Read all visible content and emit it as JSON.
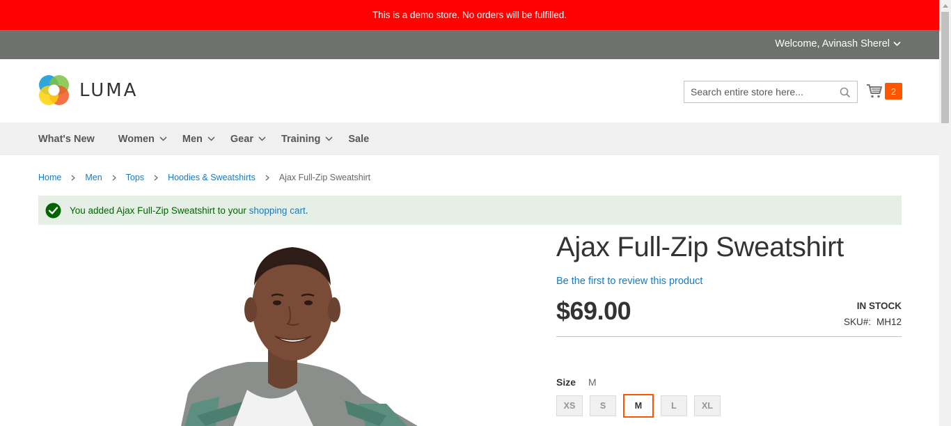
{
  "demo_notice": "This is a demo store. No orders will be fulfilled.",
  "header": {
    "welcome": "Welcome, Avinash Sherel",
    "logo_text": "LUMA",
    "search_placeholder": "Search entire store here...",
    "cart_count": "2"
  },
  "nav": {
    "items": [
      {
        "label": "What's New",
        "has_dropdown": false
      },
      {
        "label": "Women",
        "has_dropdown": true
      },
      {
        "label": "Men",
        "has_dropdown": true
      },
      {
        "label": "Gear",
        "has_dropdown": true
      },
      {
        "label": "Training",
        "has_dropdown": true
      },
      {
        "label": "Sale",
        "has_dropdown": false
      }
    ]
  },
  "breadcrumb": {
    "items": [
      "Home",
      "Men",
      "Tops",
      "Hoodies & Sweatshirts"
    ],
    "current": "Ajax Full-Zip Sweatshirt"
  },
  "message": {
    "prefix": "You added Ajax Full-Zip Sweatshirt to your ",
    "link": "shopping cart",
    "suffix": "."
  },
  "product": {
    "title": "Ajax Full-Zip Sweatshirt",
    "review_link": "Be the first to review this product",
    "price": "$69.00",
    "stock": "IN STOCK",
    "sku_label": "SKU#:",
    "sku_value": "MH12",
    "size_label": "Size",
    "size_selected": "M",
    "sizes": [
      "XS",
      "S",
      "M",
      "L",
      "XL"
    ]
  },
  "colors": {
    "demo_bar": "#ff0101",
    "panel_bar": "#6e716e",
    "link": "#1979c3",
    "accent": "#ff5501",
    "success_bg": "#e5efe5",
    "success_text": "#006400"
  }
}
